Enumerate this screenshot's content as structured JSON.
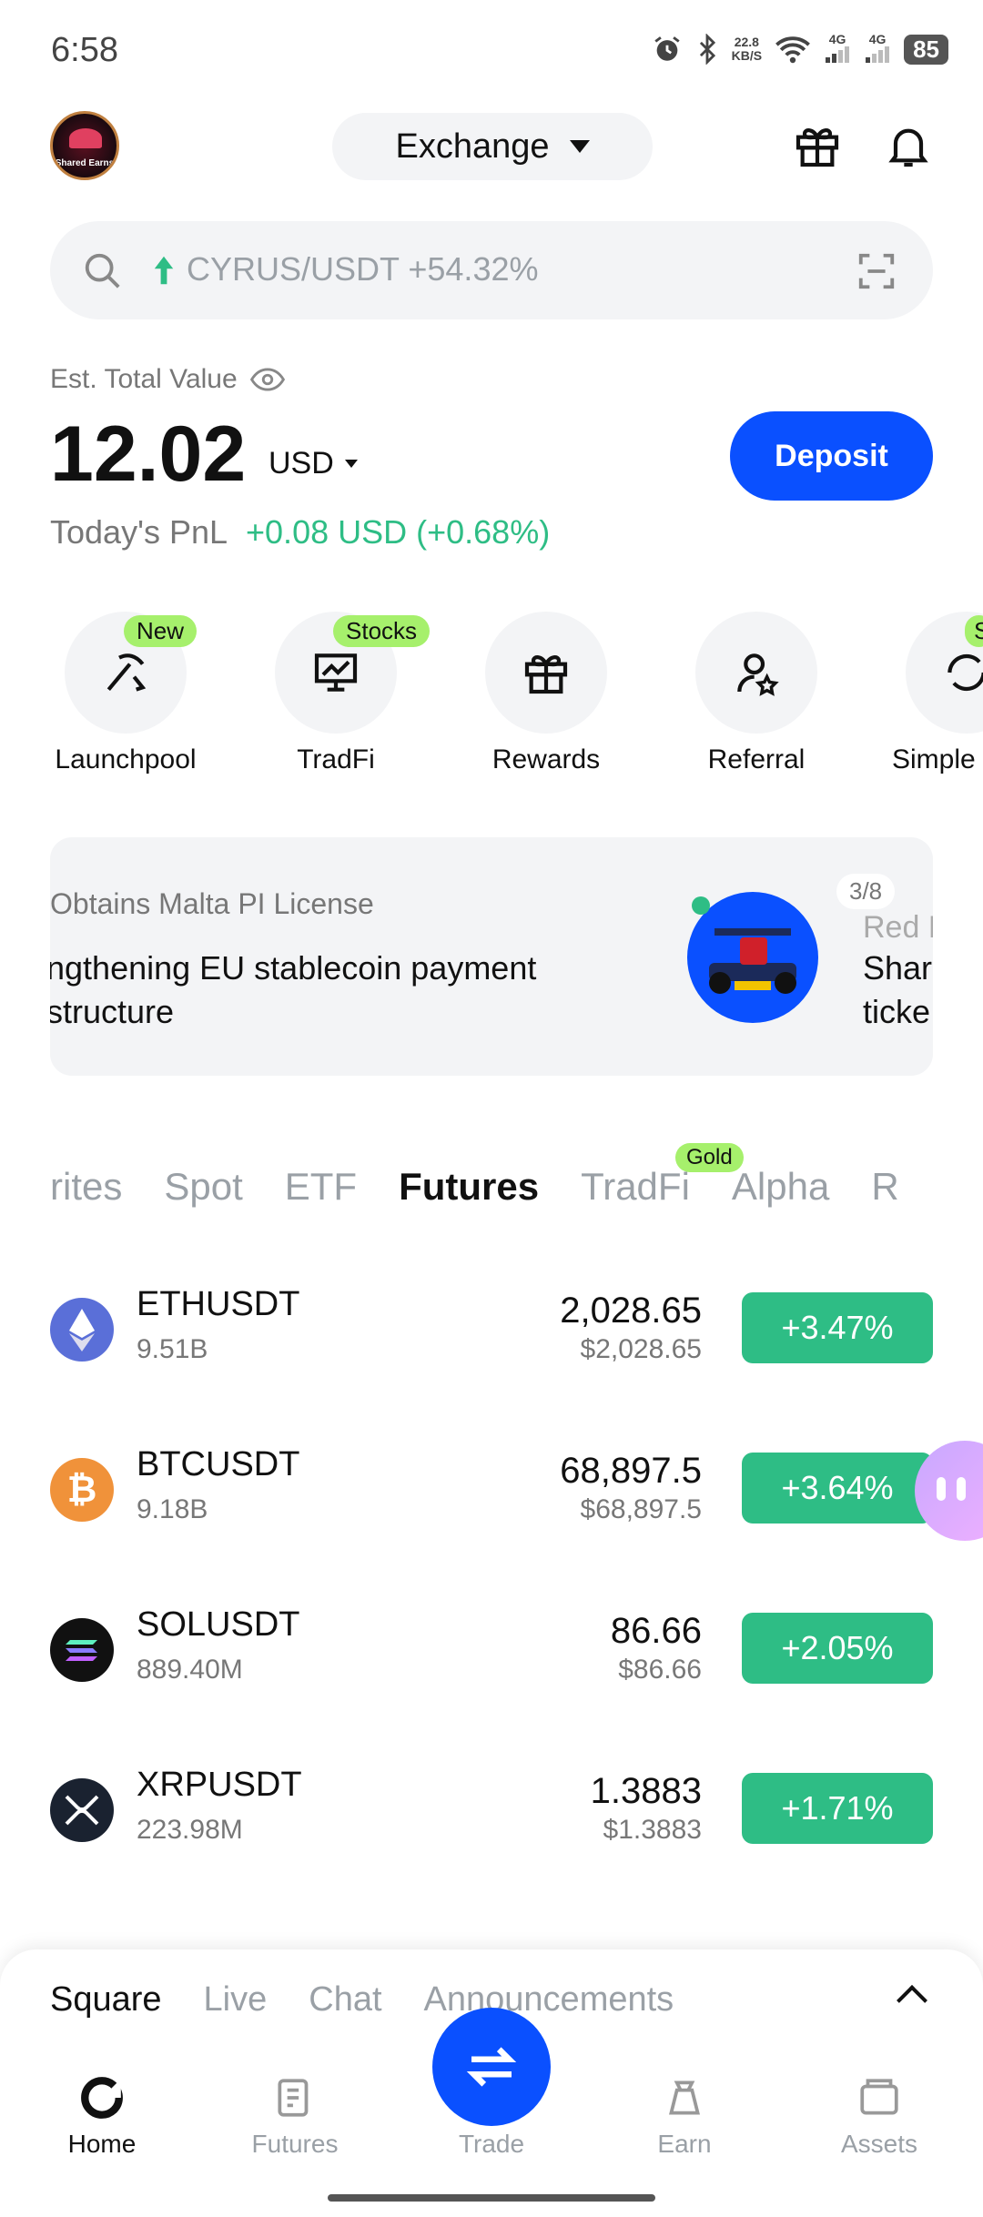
{
  "status": {
    "time": "6:58",
    "net_speed_top": "22.8",
    "net_speed_bottom": "KB/S",
    "signal1": "4G",
    "signal2": "4G",
    "battery": "85"
  },
  "header": {
    "avatar_text": "Shared Earns",
    "mode": "Exchange"
  },
  "search": {
    "placeholder": "CYRUS/USDT +54.32%"
  },
  "account": {
    "label": "Est. Total Value",
    "balance": "12.02",
    "unit": "USD",
    "deposit": "Deposit",
    "pnl_label": "Today's PnL",
    "pnl_value": "+0.08 USD (+0.68%)"
  },
  "shortcuts": [
    {
      "label": "Launchpool",
      "badge": "New"
    },
    {
      "label": "TradFi",
      "badge": "Stocks"
    },
    {
      "label": "Rewards",
      "badge": ""
    },
    {
      "label": "Referral",
      "badge": ""
    },
    {
      "label": "Simple",
      "badge": "S"
    }
  ],
  "news": {
    "subtitle": "Obtains Malta PI License",
    "title": "ngthening EU stablecoin payment structure",
    "counter": "3/8",
    "next_subtitle": "Red B",
    "next_title": "Shar ticke"
  },
  "market_tabs": [
    {
      "label": "rites",
      "active": false
    },
    {
      "label": "Spot",
      "active": false
    },
    {
      "label": "ETF",
      "active": false
    },
    {
      "label": "Futures",
      "active": true
    },
    {
      "label": "TradFi",
      "active": false
    },
    {
      "label": "Alpha",
      "active": false
    },
    {
      "label": "R",
      "active": false
    }
  ],
  "gold_badge": "Gold",
  "markets": [
    {
      "symbol": "ETHUSDT",
      "volume": "9.51B",
      "price": "2,028.65",
      "price_usd": "$2,028.65",
      "change": "+3.47%",
      "icon_color": "#5a6fd8"
    },
    {
      "symbol": "BTCUSDT",
      "volume": "9.18B",
      "price": "68,897.5",
      "price_usd": "$68,897.5",
      "change": "+3.64%",
      "icon_color": "#f0923a"
    },
    {
      "symbol": "SOLUSDT",
      "volume": "889.40M",
      "price": "86.66",
      "price_usd": "$86.66",
      "change": "+2.05%",
      "icon_color": "#111111"
    },
    {
      "symbol": "XRPUSDT",
      "volume": "223.98M",
      "price": "1.3883",
      "price_usd": "$1.3883",
      "change": "+1.71%",
      "icon_color": "#1a2230"
    }
  ],
  "sheet_tabs": [
    {
      "label": "Square",
      "active": true
    },
    {
      "label": "Live",
      "active": false
    },
    {
      "label": "Chat",
      "active": false
    },
    {
      "label": "Announcements",
      "active": false
    }
  ],
  "bottom_nav": [
    {
      "label": "Home",
      "active": true
    },
    {
      "label": "Futures",
      "active": false
    },
    {
      "label": "Trade",
      "active": false
    },
    {
      "label": "Earn",
      "active": false
    },
    {
      "label": "Assets",
      "active": false
    }
  ],
  "colors": {
    "accent": "#0a50ff",
    "up": "#2ebd85",
    "badge": "#a6f06c"
  }
}
